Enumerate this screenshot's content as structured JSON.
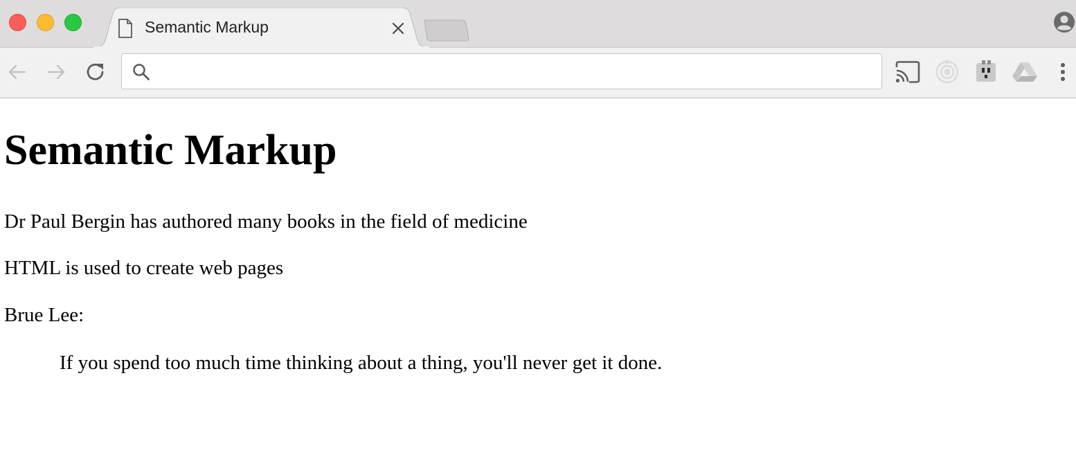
{
  "browser": {
    "tab": {
      "title": "Semantic Markup",
      "icon": "document-icon"
    },
    "address_bar": {
      "value": "",
      "placeholder": "",
      "icon": "search-icon"
    },
    "toolbar_icons": [
      "back-arrow-icon",
      "forward-arrow-icon",
      "reload-icon",
      "cast-icon",
      "record-icon",
      "extension-plug-icon",
      "drive-icon",
      "menu-dots-icon"
    ],
    "profile_icon": "profile-icon",
    "colors": {
      "tabstrip": "#dedcdd",
      "toolbar": "#f2f1f2",
      "close": "#fc5f57",
      "minimize": "#fdbc2e",
      "maximize": "#28c840"
    }
  },
  "page": {
    "heading": "Semantic Markup",
    "paragraphs": [
      "Dr Paul Bergin has authored many books in the field of medicine",
      "HTML is used to create web pages",
      "Brue Lee:"
    ],
    "quote": "If you spend too much time thinking about a thing, you'll never get it done."
  }
}
